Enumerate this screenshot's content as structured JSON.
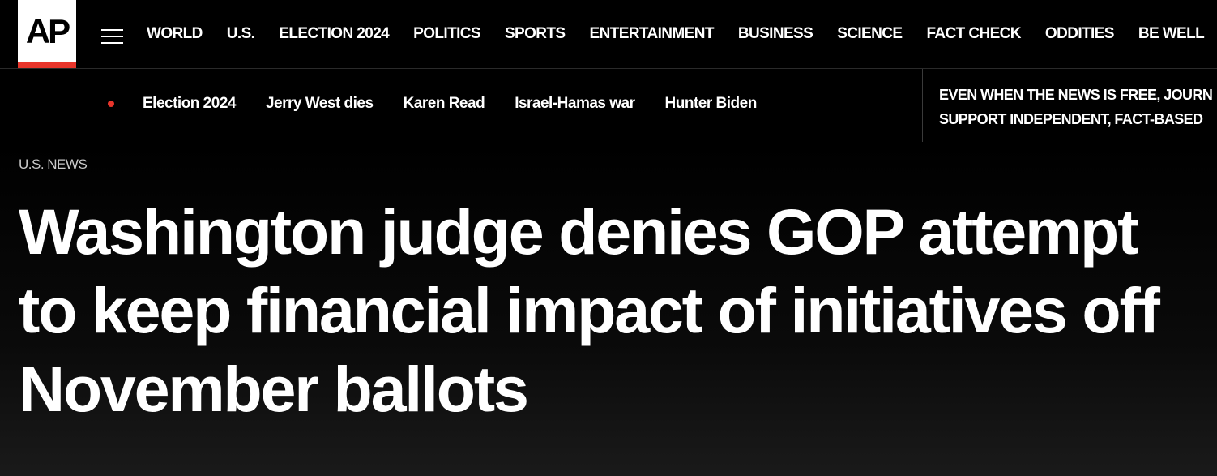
{
  "logo": {
    "text": "AP",
    "bar_color": "#e8352b"
  },
  "nav": {
    "menu_icon": "hamburger-menu-icon",
    "links": [
      "WORLD",
      "U.S.",
      "ELECTION 2024",
      "POLITICS",
      "SPORTS",
      "ENTERTAINMENT",
      "BUSINESS",
      "SCIENCE",
      "FACT CHECK",
      "ODDITIES",
      "BE WELL"
    ]
  },
  "trending": {
    "indicator_color": "#e8352b",
    "links": [
      "Election 2024",
      "Jerry West dies",
      "Karen Read",
      "Israel-Hamas war",
      "Hunter Biden"
    ]
  },
  "promo": {
    "line1": "EVEN WHEN THE NEWS IS FREE, JOURN",
    "line2": "SUPPORT INDEPENDENT, FACT-BASED"
  },
  "article": {
    "section": "U.S. NEWS",
    "headline": "Washington judge denies GOP attempt to keep financial impact of initiatives off November ballots"
  }
}
